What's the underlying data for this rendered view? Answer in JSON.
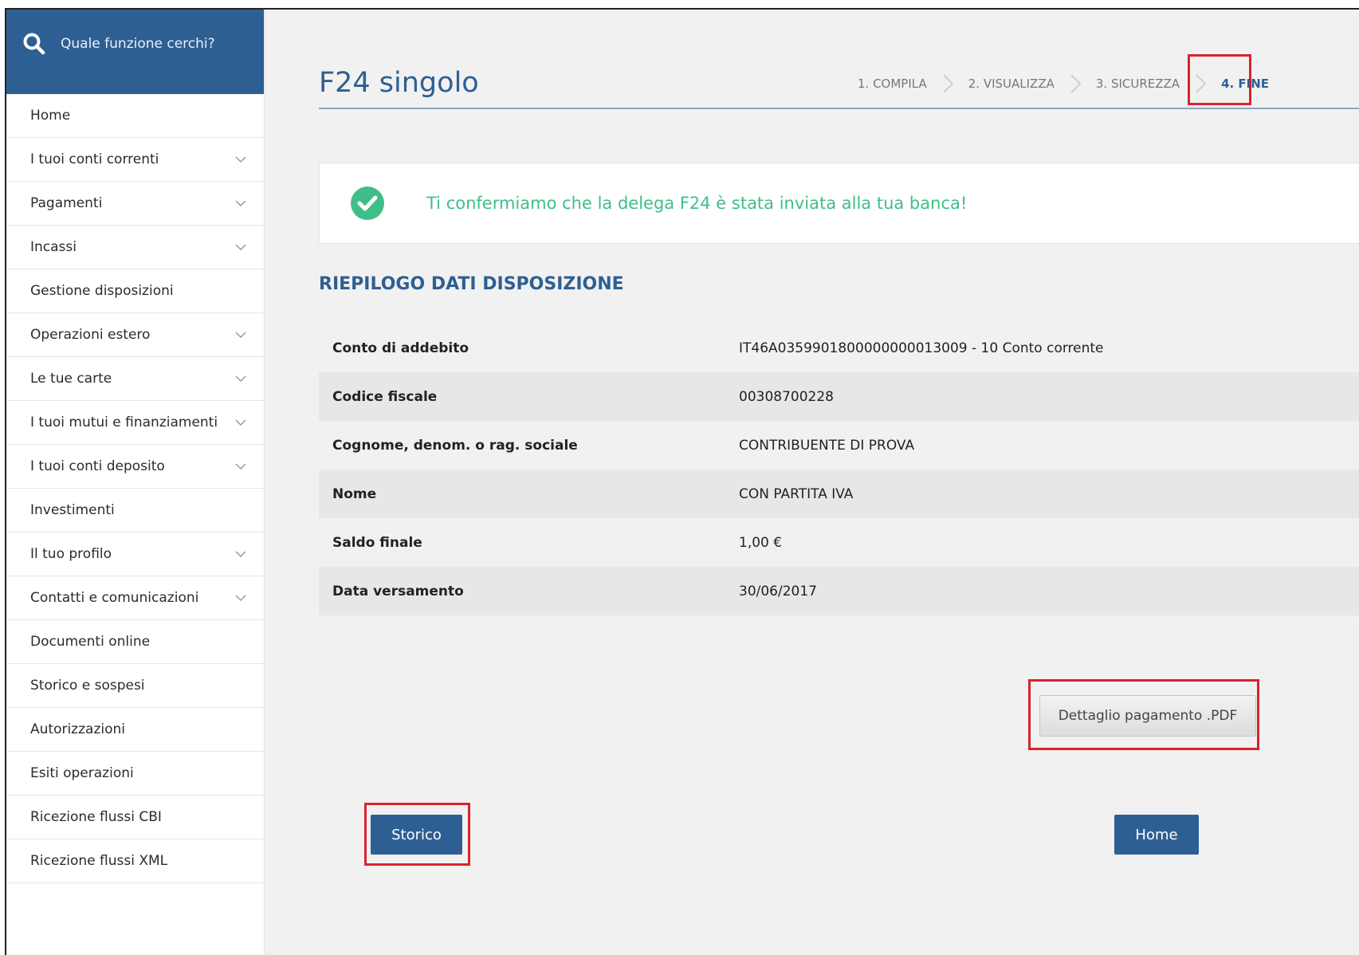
{
  "colors": {
    "primary": "#2e5f93",
    "success": "#3fbf87",
    "highlight": "#d9232d"
  },
  "search": {
    "placeholder": "Quale funzione cerchi?",
    "icon": "search-icon"
  },
  "sidebar": {
    "items": [
      {
        "label": "Home",
        "expandable": false
      },
      {
        "label": "I tuoi conti correnti",
        "expandable": true
      },
      {
        "label": "Pagamenti",
        "expandable": true
      },
      {
        "label": "Incassi",
        "expandable": true
      },
      {
        "label": "Gestione disposizioni",
        "expandable": false
      },
      {
        "label": "Operazioni estero",
        "expandable": true
      },
      {
        "label": "Le tue carte",
        "expandable": true
      },
      {
        "label": "I tuoi mutui e finanziamenti",
        "expandable": true
      },
      {
        "label": "I tuoi conti deposito",
        "expandable": true
      },
      {
        "label": "Investimenti",
        "expandable": false
      },
      {
        "label": "Il tuo profilo",
        "expandable": true
      },
      {
        "label": "Contatti e comunicazioni",
        "expandable": true
      },
      {
        "label": "Documenti online",
        "expandable": false
      },
      {
        "label": "Storico e sospesi",
        "expandable": false
      },
      {
        "label": "Autorizzazioni",
        "expandable": false
      },
      {
        "label": "Esiti operazioni",
        "expandable": false
      },
      {
        "label": "Ricezione flussi CBI",
        "expandable": false
      },
      {
        "label": "Ricezione flussi XML",
        "expandable": false
      }
    ]
  },
  "page": {
    "title": "F24 singolo"
  },
  "steps": [
    {
      "label": "1. COMPILA",
      "active": false
    },
    {
      "label": "2. VISUALIZZA",
      "active": false
    },
    {
      "label": "3. SICUREZZA",
      "active": false
    },
    {
      "label": "4. FINE",
      "active": true
    }
  ],
  "confirmation": {
    "message": "Ti confermiamo che la delega F24 è stata inviata alla tua banca!",
    "icon": "check-circle-icon"
  },
  "summary": {
    "title": "RIEPILOGO DATI DISPOSIZIONE",
    "rows": [
      {
        "label": "Conto di addebito",
        "value": "IT46A0359901800000000013009 - 10 Conto corrente"
      },
      {
        "label": "Codice fiscale",
        "value": "00308700228"
      },
      {
        "label": "Cognome, denom. o rag. sociale",
        "value": "CONTRIBUENTE DI PROVA"
      },
      {
        "label": "Nome",
        "value": "CON PARTITA IVA"
      },
      {
        "label": "Saldo finale",
        "value": "1,00 €"
      },
      {
        "label": "Data versamento",
        "value": "30/06/2017"
      }
    ]
  },
  "buttons": {
    "pdf": "Dettaglio pagamento .PDF",
    "storico": "Storico",
    "home": "Home"
  }
}
